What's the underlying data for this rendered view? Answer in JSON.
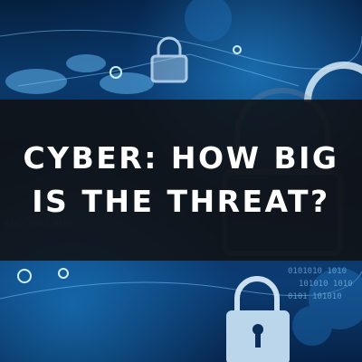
{
  "headline": {
    "line1": "CYBER: HOW BIG",
    "line2": "IS THE THREAT?"
  },
  "background": {
    "theme": "blue digital network with padlock icons and binary code",
    "icons": [
      "padlock-icon",
      "gear-icon",
      "world-map"
    ],
    "binary_text": "0101010 101010 1010",
    "colors": {
      "deep_navy": "#04101f",
      "glow_blue": "#2b95e6",
      "banner": "#101012"
    }
  }
}
